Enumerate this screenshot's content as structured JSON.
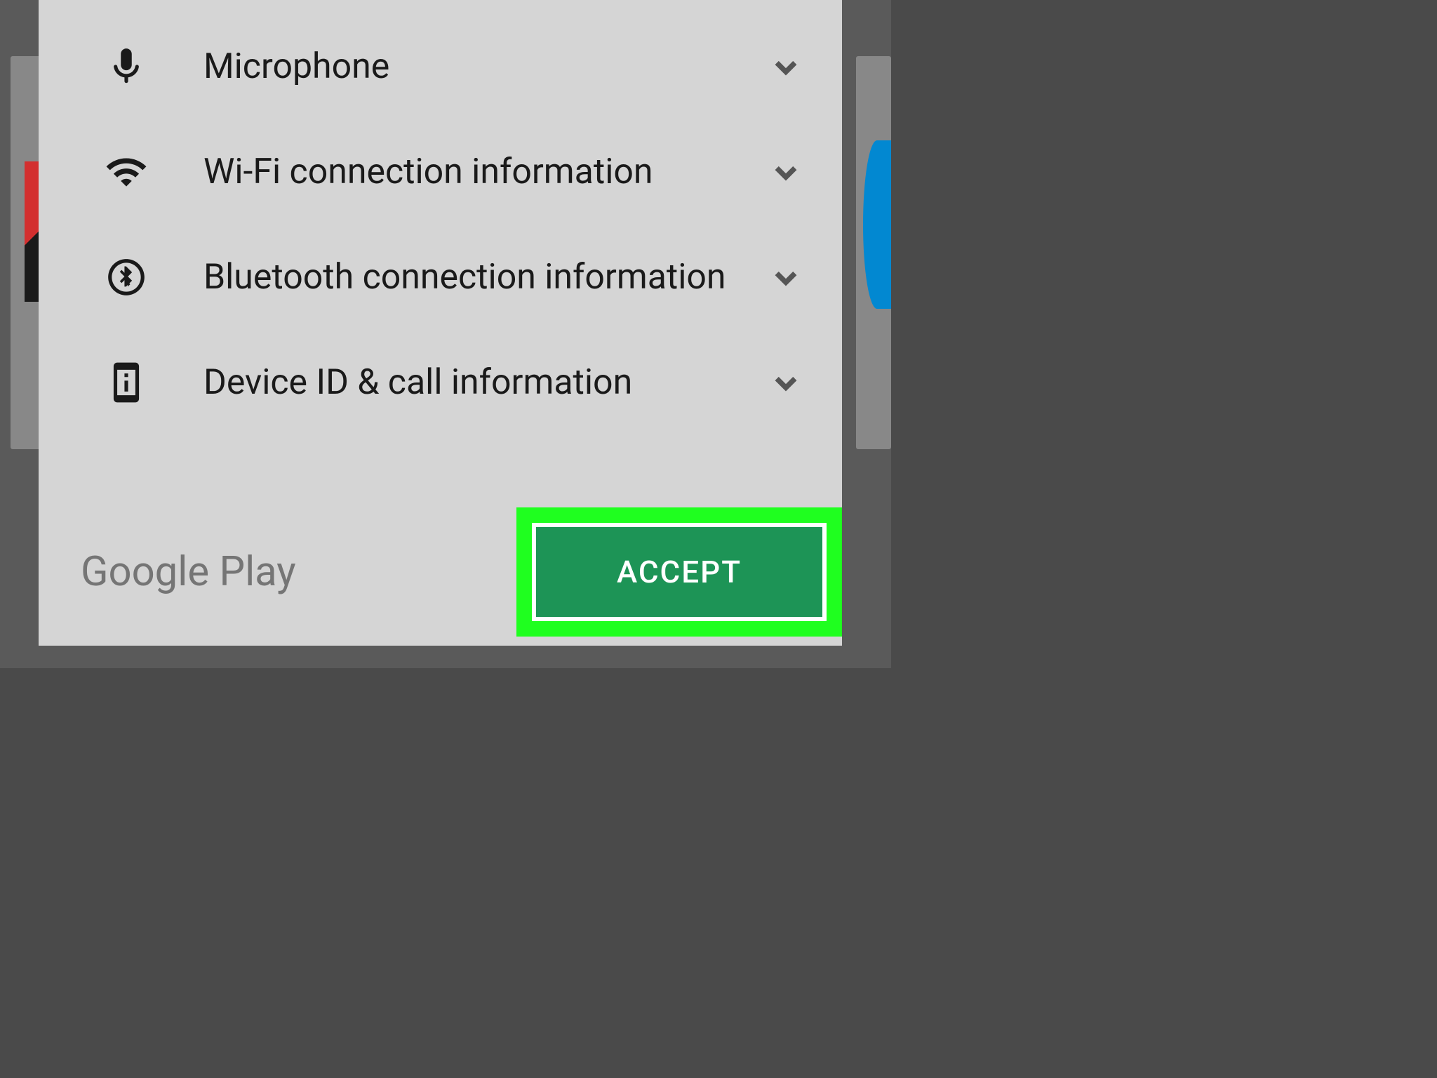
{
  "permissions": [
    {
      "icon": "microphone-icon",
      "label": "Microphone"
    },
    {
      "icon": "wifi-icon",
      "label": "Wi-Fi connection information"
    },
    {
      "icon": "bluetooth-icon",
      "label": "Bluetooth connection information"
    },
    {
      "icon": "device-info-icon",
      "label": "Device ID & call information"
    }
  ],
  "footer": {
    "brand_label": "Google Play",
    "accept_label": "ACCEPT"
  }
}
